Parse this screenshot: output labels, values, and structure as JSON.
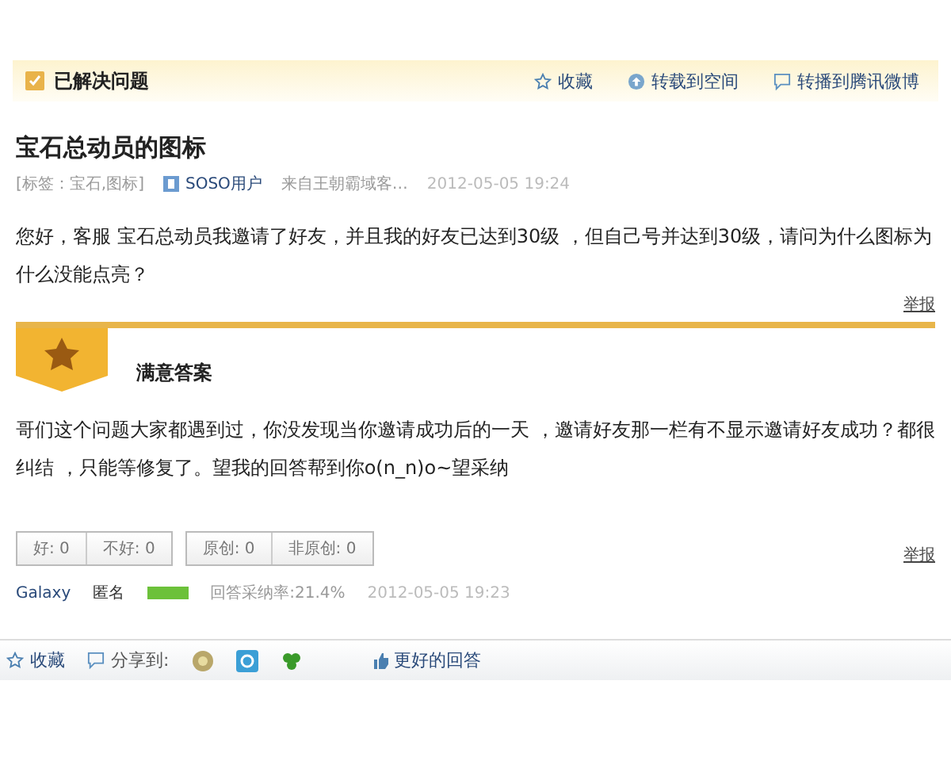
{
  "header": {
    "title": "已解决问题",
    "actions": [
      {
        "kind": "star",
        "label": "收藏"
      },
      {
        "kind": "upload",
        "label": "转载到空间"
      },
      {
        "kind": "bubble",
        "label": "转播到腾讯微博"
      }
    ]
  },
  "question": {
    "title": "宝石总动员的图标",
    "tags": "[标签：宝石,图标]",
    "user": "SOSO用户",
    "source": "来自王朝霸域客…",
    "time": "2012-05-05 19:24",
    "body": "您好，客服 宝石总动员我邀请了好友，并且我的好友已达到30级 ，但自己号并达到30级，请问为什么图标为什么没能点亮？",
    "report": "举报"
  },
  "answer": {
    "heading": "满意答案",
    "body": "哥们这个问题大家都遇到过，你没发现当你邀请成功后的一天 ，邀请好友那一栏有不显示邀请好友成功？都很纠结 ，只能等修复了。望我的回答帮到你o(n_n)o~望采纳",
    "votes": [
      [
        "好: 0",
        "不好: 0"
      ],
      [
        "原创: 0",
        "非原创: 0"
      ]
    ],
    "report": "举报",
    "author": "Galaxy",
    "anon": "匿名",
    "rate": "回答采纳率:21.4%",
    "time": "2012-05-05 19:23"
  },
  "toolbar": {
    "favorite": "收藏",
    "share": "分享到:",
    "better": "更好的回答"
  }
}
